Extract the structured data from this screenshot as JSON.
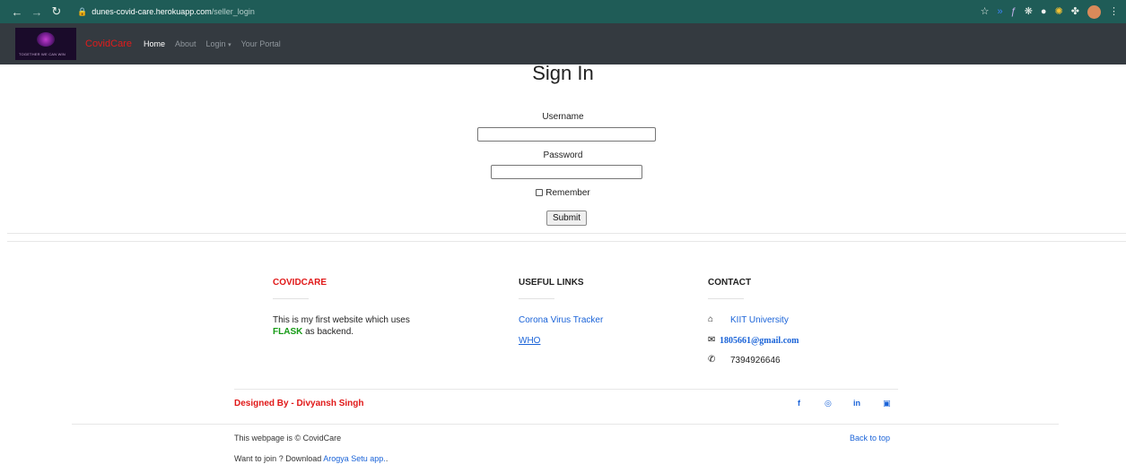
{
  "browser": {
    "url_host": "dunes-covid-care.herokuapp.com",
    "url_path": "/seller_login"
  },
  "navbar": {
    "logo_tagline": "TOGETHER WE CAN WIN",
    "brand": "CovidCare",
    "links": [
      "Home",
      "About",
      "Login",
      "Your Portal"
    ],
    "login_caret": "▾"
  },
  "form": {
    "title": "Sign In",
    "username_label": "Username",
    "username_value": "",
    "password_label": "Password",
    "password_value": "",
    "remember_label": "Remember",
    "remember_checked": false,
    "submit_label": "Submit"
  },
  "footer": {
    "about": {
      "heading": "COVIDCARE",
      "text_before": "This is my first website which uses",
      "highlight": "FLASK",
      "text_after": "as backend."
    },
    "useful_links": {
      "heading": "USEFUL LINKS",
      "links": [
        "Corona Virus Tracker",
        "WHO"
      ]
    },
    "contact": {
      "heading": "CONTACT",
      "address": "KIIT University",
      "email": "1805661@gmail.com",
      "phone": "7394926646"
    },
    "designer": "Designed By - Divyansh Singh",
    "social_icons": [
      "facebook-icon",
      "instagram-icon",
      "linkedin-icon",
      "twitter-icon"
    ],
    "copyright": "This webpage is © CovidCare",
    "back_to_top": "Back to top",
    "join_text": "Want to join ? Download",
    "join_link": "Arogya Setu app.",
    "join_suffix": "."
  },
  "colors": {
    "browser_chrome": "#1f5c57",
    "navbar_bg": "#343a40",
    "brand_red": "#e21b1b",
    "link_blue": "#1a63d8",
    "flask_green": "#159a15"
  }
}
